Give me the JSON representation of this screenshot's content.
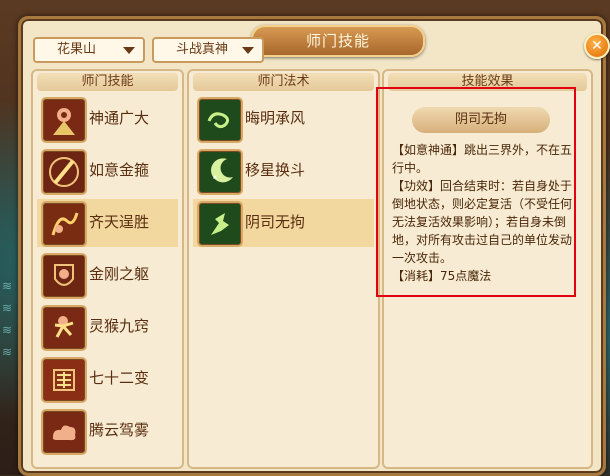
{
  "window": {
    "title": "师门技能"
  },
  "filters": {
    "school": "花果山",
    "category": "斗战真神"
  },
  "columns": {
    "skills_header": "师门技能",
    "spells_header": "师门法术",
    "effect_header": "技能效果"
  },
  "skills": [
    {
      "label": "神通广大",
      "icon": "monkey-king-icon"
    },
    {
      "label": "如意金箍",
      "icon": "golden-staff-icon"
    },
    {
      "label": "齐天逞胜",
      "icon": "fire-whip-icon",
      "selected": true
    },
    {
      "label": "金刚之躯",
      "icon": "armor-icon"
    },
    {
      "label": "灵猴九窍",
      "icon": "agile-monkey-icon"
    },
    {
      "label": "七十二变",
      "icon": "transform-glyph-icon"
    },
    {
      "label": "腾云驾雾",
      "icon": "cloud-icon"
    }
  ],
  "spells": [
    {
      "label": "晦明承风",
      "icon": "wind-swirl-icon"
    },
    {
      "label": "移星换斗",
      "icon": "star-shift-icon"
    },
    {
      "label": "阴司无拘",
      "icon": "ghost-escape-icon",
      "selected": true
    }
  ],
  "effect": {
    "name": "阴司无拘",
    "line1": "【如意神通】跳出三界外，不在五行中。",
    "line2": "【功效】回合结束时：若自身处于倒地状态，则必定复活（不受任何无法复活效果影响）；若自身未倒地，对所有攻击过自己的单位发动一次攻击。",
    "line3": "【消耗】75点魔法"
  },
  "colors": {
    "accent_frame": "#e3000f",
    "window_bg": "#f3e6c7",
    "text_brown": "#5a2e10"
  }
}
